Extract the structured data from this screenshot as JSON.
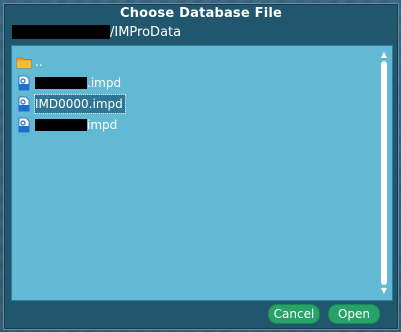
{
  "dialog": {
    "title": "Choose Database File",
    "path_suffix": "/IMProData"
  },
  "files": [
    {
      "name": "..",
      "icon": "folder-up-icon",
      "redacted": false,
      "selected": false
    },
    {
      "name": ".impd",
      "icon": "database-file-icon",
      "redacted": true,
      "selected": false
    },
    {
      "name": "IMD0000.impd",
      "icon": "database-file-icon",
      "redacted": false,
      "selected": true
    },
    {
      "name": "impd",
      "icon": "database-file-icon",
      "redacted": true,
      "selected": false
    }
  ],
  "buttons": {
    "cancel": "Cancel",
    "open": "Open"
  }
}
